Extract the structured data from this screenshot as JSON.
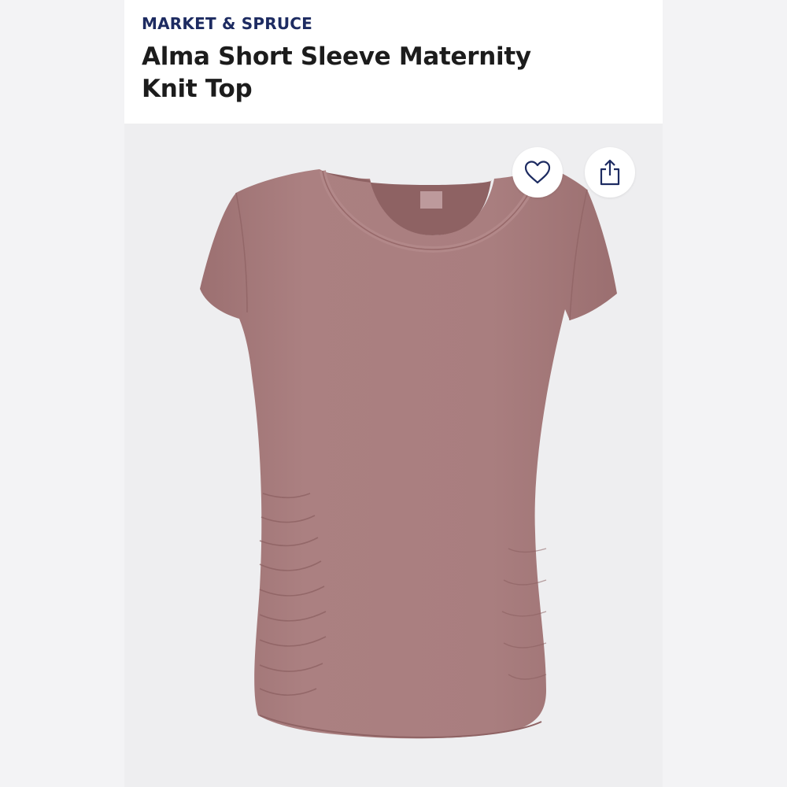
{
  "product": {
    "brand": "MARKET & SPRUCE",
    "title": "Alma Short Sleeve Maternity Knit Top"
  },
  "actions": {
    "favorite_icon": "heart-icon",
    "share_icon": "share-icon"
  },
  "image": {
    "subject": "short-sleeve-top",
    "garment_color": "#a77b7c"
  },
  "colors": {
    "brand": "#1d2b61",
    "title": "#1c1c1c",
    "background": "#eeeef0"
  }
}
